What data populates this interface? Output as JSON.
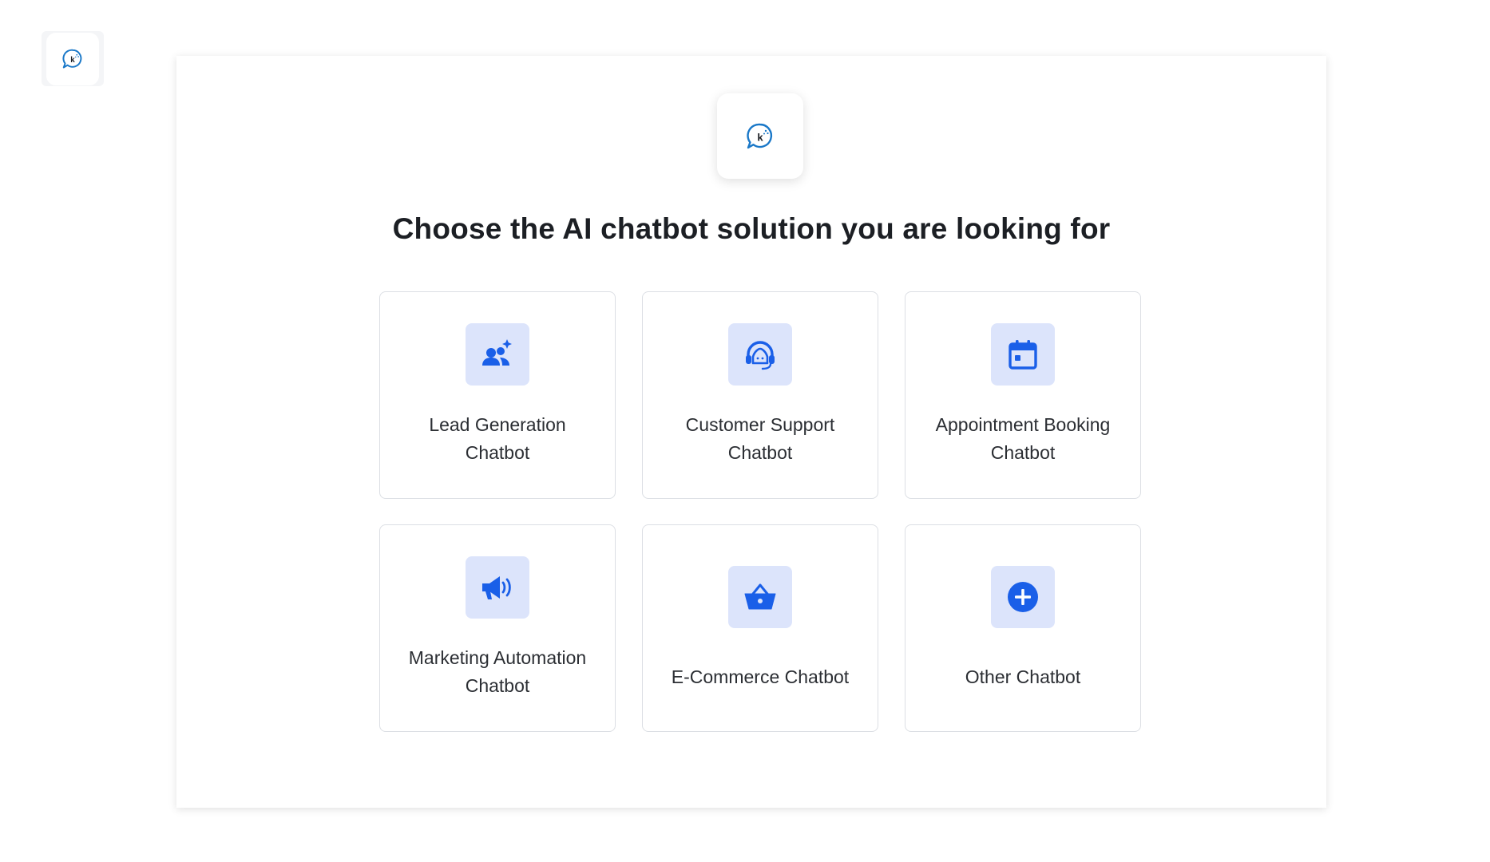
{
  "brand": {
    "logo_icon": "kommunicate-chat-bubble-icon",
    "logo_letter": "k",
    "accent_color": "#1a5fe8",
    "icon_bg_color": "#dce4fb"
  },
  "main": {
    "title": "Choose the AI chatbot solution you are looking for",
    "options": [
      {
        "line1": "Lead Generation",
        "line2": "Chatbot",
        "icon": "users-sparkle-icon"
      },
      {
        "line1": "Customer Support",
        "line2": "Chatbot",
        "icon": "headset-icon"
      },
      {
        "line1": "Appointment Booking",
        "line2": "Chatbot",
        "icon": "calendar-icon"
      },
      {
        "line1": "Marketing Automation",
        "line2": "Chatbot",
        "icon": "megaphone-icon"
      },
      {
        "line1": "E-Commerce Chatbot",
        "line2": "",
        "icon": "shopping-basket-icon"
      },
      {
        "line1": "Other Chatbot",
        "line2": "",
        "icon": "plus-circle-icon"
      }
    ]
  }
}
